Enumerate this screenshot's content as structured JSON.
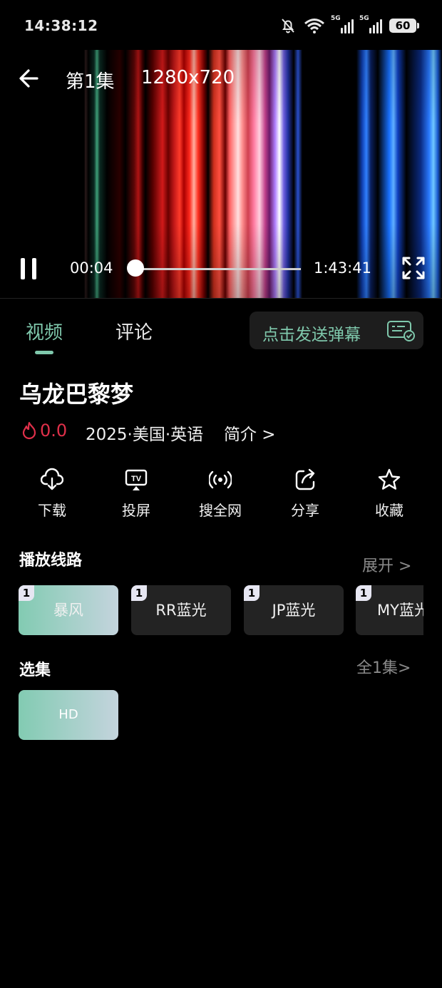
{
  "status_bar": {
    "time": "14:38:12",
    "network_labels": [
      "5G",
      "5G"
    ],
    "battery": "60",
    "icons": [
      "bell-muted-icon",
      "wifi-icon",
      "signal-icon",
      "signal-icon",
      "battery-icon"
    ]
  },
  "player": {
    "episode": "第1集",
    "resolution": "1280x720",
    "current_time": "00:04",
    "total_time": "1:43:41",
    "progress": 0.0
  },
  "tabs": [
    {
      "label": "视频",
      "active": true
    },
    {
      "label": "评论",
      "active": false
    }
  ],
  "danmaku": {
    "label": "点击发送弹幕",
    "icon": "danmaku-settings-icon"
  },
  "movie": {
    "title": "乌龙巴黎梦",
    "rating": "0.0",
    "meta": "2025·美国·英语",
    "intro_link": "简介 >"
  },
  "actions": [
    {
      "label": "下载",
      "icon": "download-icon"
    },
    {
      "label": "投屏",
      "icon": "cast-tv-icon"
    },
    {
      "label": "搜全网",
      "icon": "broadcast-icon"
    },
    {
      "label": "分享",
      "icon": "share-icon"
    },
    {
      "label": "收藏",
      "icon": "star-icon"
    }
  ],
  "routes": {
    "title": "播放线路",
    "expand": "展开 >",
    "items": [
      {
        "badge": "1",
        "label": "暴风",
        "selected": true
      },
      {
        "badge": "1",
        "label": "RR蓝光",
        "selected": false
      },
      {
        "badge": "1",
        "label": "JP蓝光",
        "selected": false
      },
      {
        "badge": "1",
        "label": "MY蓝光",
        "selected": false
      }
    ]
  },
  "episodes": {
    "title": "选集",
    "all_label": "全1集>",
    "items": [
      {
        "label": "HD",
        "selected": true
      }
    ]
  },
  "colors": {
    "accent": "#7fc8ac",
    "rating": "#e0304a",
    "selected_gradient_start": "#82cbb2",
    "selected_gradient_end": "#c4d4dd",
    "button_bg": "#232323"
  }
}
